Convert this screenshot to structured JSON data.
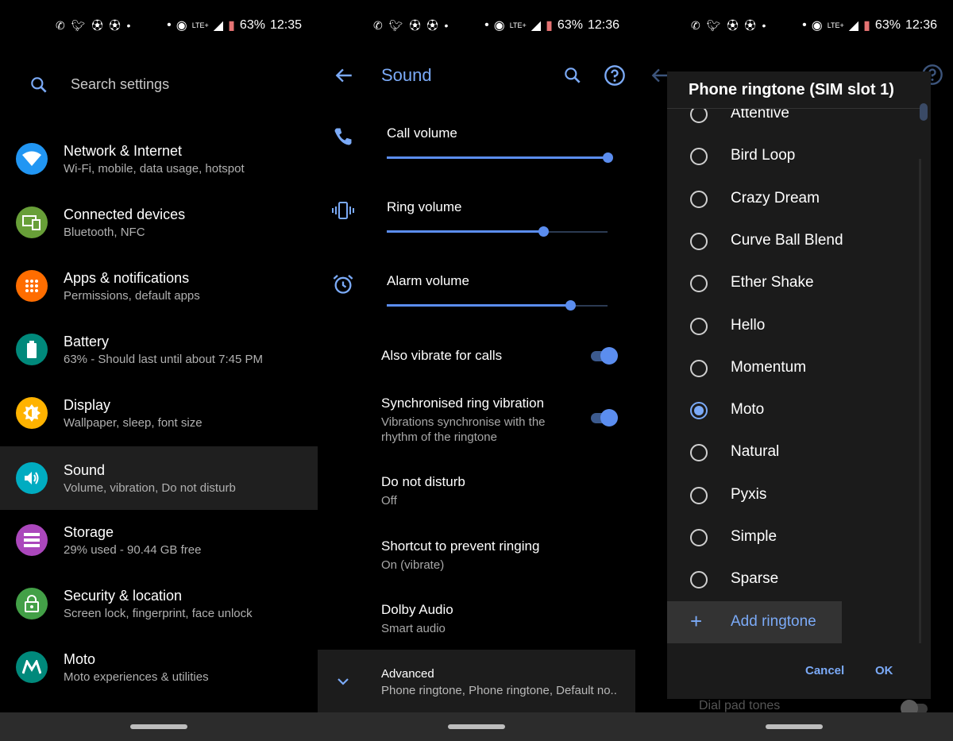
{
  "status": {
    "panel1": {
      "battery": "63%",
      "time": "12:35"
    },
    "panel2": {
      "battery": "63%",
      "time": "12:36"
    },
    "panel3": {
      "battery": "63%",
      "time": "12:36"
    },
    "network": "LTE+"
  },
  "settings": {
    "search_placeholder": "Search settings",
    "items": [
      {
        "title": "Network & Internet",
        "subtitle": "Wi-Fi, mobile, data usage, hotspot",
        "color": "#2196f3",
        "icon": "wifi-icon"
      },
      {
        "title": "Connected devices",
        "subtitle": "Bluetooth, NFC",
        "color": "#689f38",
        "icon": "devices-icon"
      },
      {
        "title": "Apps & notifications",
        "subtitle": "Permissions, default apps",
        "color": "#ff6d00",
        "icon": "apps-icon"
      },
      {
        "title": "Battery",
        "subtitle": "63% - Should last until about 7:45 PM",
        "color": "#00897b",
        "icon": "battery-icon"
      },
      {
        "title": "Display",
        "subtitle": "Wallpaper, sleep, font size",
        "color": "#ffb300",
        "icon": "brightness-icon"
      },
      {
        "title": "Sound",
        "subtitle": "Volume, vibration, Do not disturb",
        "color": "#00acc1",
        "icon": "volume-icon"
      },
      {
        "title": "Storage",
        "subtitle": "29% used - 90.44 GB free",
        "color": "#ab47bc",
        "icon": "storage-icon"
      },
      {
        "title": "Security & location",
        "subtitle": "Screen lock, fingerprint, face unlock",
        "color": "#43a047",
        "icon": "lock-icon"
      },
      {
        "title": "Moto",
        "subtitle": "Moto experiences & utilities",
        "color": "#00897b",
        "icon": "moto-logo-icon"
      }
    ]
  },
  "sound": {
    "title": "Sound",
    "volumes": [
      {
        "label": "Call volume",
        "level": 1.0,
        "icon": "phone-icon"
      },
      {
        "label": "Ring volume",
        "level": 0.71,
        "icon": "vibrate-icon"
      },
      {
        "label": "Alarm volume",
        "level": 0.83,
        "icon": "alarm-icon"
      }
    ],
    "also_vibrate": {
      "title": "Also vibrate for calls",
      "on": true
    },
    "sync_vibration": {
      "title": "Synchronised ring vibration",
      "subtitle": "Vibrations synchronise with the rhythm of the ringtone",
      "on": true
    },
    "dnd": {
      "title": "Do not disturb",
      "subtitle": "Off"
    },
    "shortcut": {
      "title": "Shortcut to prevent ringing",
      "subtitle": "On (vibrate)"
    },
    "dolby": {
      "title": "Dolby Audio",
      "subtitle": "Smart audio"
    },
    "advanced": {
      "title": "Advanced",
      "subtitle": "Phone ringtone, Phone ringtone, Default no.."
    }
  },
  "ringtone_dialog": {
    "title": "Phone ringtone (SIM slot 1)",
    "options": [
      "Attentive",
      "Bird Loop",
      "Crazy Dream",
      "Curve Ball Blend",
      "Ether Shake",
      "Hello",
      "Momentum",
      "Moto",
      "Natural",
      "Pyxis",
      "Simple",
      "Sparse"
    ],
    "selected": "Moto",
    "add_label": "Add ringtone",
    "cancel_label": "Cancel",
    "ok_label": "OK",
    "background_row": "Dial pad tones"
  }
}
